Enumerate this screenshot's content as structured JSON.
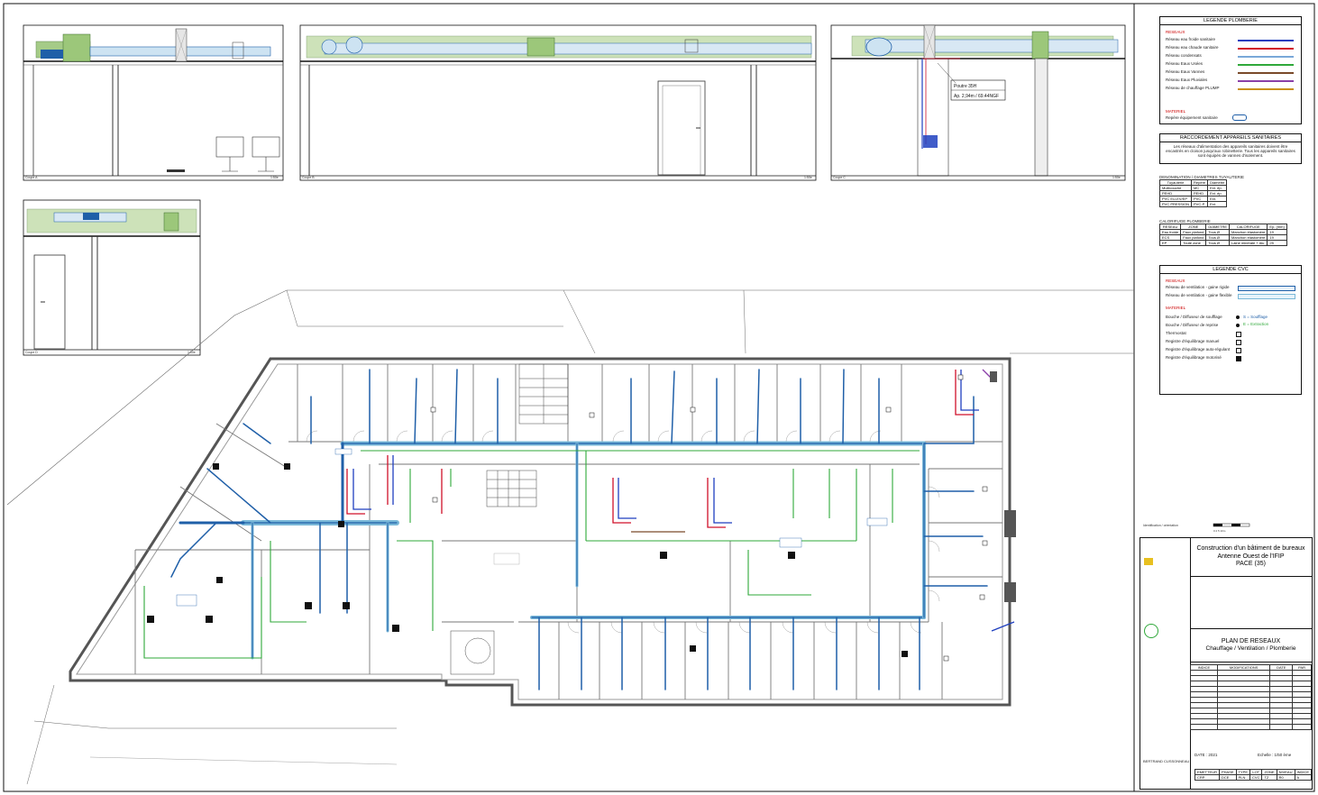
{
  "sections": {
    "s1": {
      "label": "Coupe A",
      "scale": "1:50e"
    },
    "s2": {
      "label": "Coupe B",
      "scale": "1:50e"
    },
    "s3": {
      "label": "Coupe C",
      "scale": "1:50e",
      "annotation_1": "Poutre 35H",
      "annotation_2": "Ap. 2,94m / 69.44NGF"
    },
    "s4": {
      "label": "Coupe D",
      "scale": "1:50e"
    }
  },
  "legend_plomberie": {
    "title": "LEGENDE PLOMBERIE",
    "reseaux_label": "RESEAUX",
    "items": [
      {
        "label": "Réseau eau froide sanitaire",
        "color": "#1f3fbf"
      },
      {
        "label": "Réseau eau chaude sanitaire",
        "color": "#d0102a"
      },
      {
        "label": "Réseau condensats",
        "color": "#7aa8d8"
      },
      {
        "label": "Réseau Eaux Usées",
        "color": "#2fa83a"
      },
      {
        "label": "Réseau Eaux Vannes",
        "color": "#7a4a2a"
      },
      {
        "label": "Réseau Eaux Pluviales",
        "color": "#8a3fa8"
      },
      {
        "label": "Réseau de chauffage PLUMP",
        "color": "#c8901a"
      }
    ],
    "materiel_label": "MATERIEL",
    "materiel_item": "Repère équipement sanitaire"
  },
  "raccordement": {
    "title": "RACCORDEMENT APPAREILS SANITAIRES",
    "text": "Les réseaux d'alimentation des appareils sanitaires doivent être encastrés en cloison jusqu'aux robinetterie. Tous les appareils sanitaires sont équipés de vannes d'isolement."
  },
  "denomination": {
    "title": "DENOMINATION / DIAMETRES TUYAUTERIE",
    "headers": [
      "Tuyauterie",
      "Repère",
      "Diamètre"
    ],
    "rows": [
      [
        "Multicouche",
        "MC",
        "Ext. ép."
      ],
      [
        "PEHD",
        "PEHD",
        "Ext. ép."
      ],
      [
        "PVC EU-EV/EP",
        "PVC",
        "Ext."
      ],
      [
        "PVC PRESSION",
        "PVC-P",
        "Ext."
      ]
    ]
  },
  "calorifuge": {
    "title": "CALORIFUGE PLOMBERIE",
    "headers": [
      "RESEAU",
      "ZONE",
      "DIAMETRE",
      "CALORIFUGE",
      "Ep. (mm)"
    ],
    "rows": [
      [
        "Eau froide",
        "Faux plafond",
        "Tous Ø",
        "Manchon élastomère",
        "19"
      ],
      [
        "ECS",
        "Faux plafond",
        "Tous Ø",
        "Manchon élastomère",
        "19"
      ],
      [
        "EP",
        "Toute zone",
        "Tous Ø",
        "Laine minérale + Alu",
        "25"
      ]
    ]
  },
  "legend_cvc": {
    "title": "LEGENDE CVC",
    "reseaux_label": "RESEAUX",
    "items": [
      {
        "label": "Réseau de ventilation - gaine rigide",
        "color": "#1f5fa8"
      },
      {
        "label": "Réseau de ventilation - gaine flexible",
        "color": "#7ab8d8"
      }
    ],
    "materiel_label": "MATERIEL",
    "materiel": [
      "Bouche / Diffuseur de soufflage",
      "Bouche / Diffuseur de reprise",
      "Thermostat",
      "Registre d'équilibrage manuel",
      "Registre d'équilibrage auto-régulant",
      "Registre d'équilibrage motorisé"
    ],
    "soufflage_note": "S = Soufflage",
    "extraction_note": "E = Extraction"
  },
  "plan": {
    "note_left": "Identification / orientation",
    "scale_bar_label": "0      2      5      10m"
  },
  "title_block": {
    "project_line1": "Construction d'un bâtiment de bureaux",
    "project_line2": "Antenne Ouest de l'IFIP",
    "project_line3": "PACE (35)",
    "plan_title": "PLAN DE RESEAUX",
    "plan_subtitle": "Chauffage / Ventilation / Plomberie",
    "rev_headers": [
      "INDICE",
      "MODIFICATIONS",
      "DATE",
      "PAR"
    ],
    "bottom_headers": [
      "EMETTEUR",
      "PHASE",
      "TYPE",
      "LOT",
      "ZONE",
      "NIVEAU",
      "INDICE"
    ],
    "bottom_values": [
      "CRP",
      "DCE",
      "PLN",
      "CVC",
      "TZ",
      "R0",
      "A"
    ],
    "firm": "BERTRAND CUSSONNEAU",
    "date_label": "DATE : 2021",
    "ech_label": "Echelle : 1/50 ème"
  }
}
